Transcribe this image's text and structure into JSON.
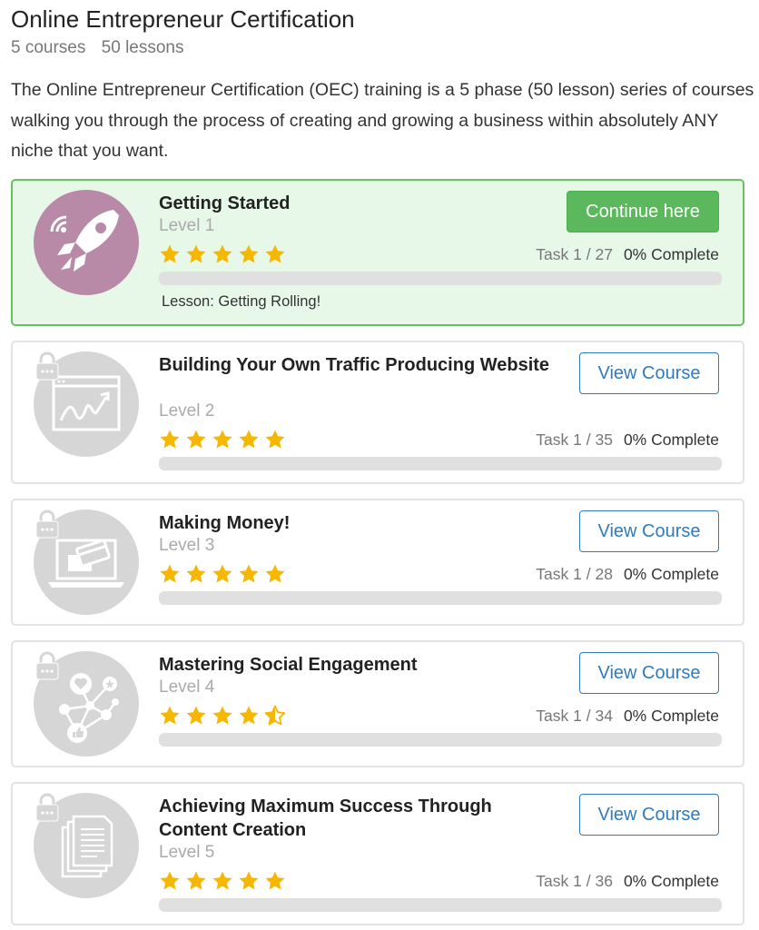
{
  "page": {
    "title": "Online Entrepreneur Certification",
    "courses_count": "5 courses",
    "lessons_count": "50 lessons",
    "description": "The Online Entrepreneur Certification (OEC) training is a 5 phase (50 lesson) series of courses walking you through the process of creating and growing a business within absolutely ANY niche that you want."
  },
  "colors": {
    "active_border": "#66c15f",
    "active_background": "#e8f8e8",
    "continue_button": "#5cb85c",
    "view_button": "#2e7bbf",
    "star": "#f5b700",
    "active_icon": "#b98aa8",
    "locked_icon": "#d6d6d6"
  },
  "courses": [
    {
      "title": "Getting Started",
      "level": "Level 1",
      "rating": 5,
      "task": "Task 1 / 27",
      "complete": "0% Complete",
      "progress": 0,
      "button": "Continue here",
      "lesson": "Lesson: Getting Rolling!",
      "icon": "rocket-icon",
      "locked": false
    },
    {
      "title": "Building Your Own Traffic Producing Website",
      "level": "Level 2",
      "rating": 5,
      "task": "Task 1 / 35",
      "complete": "0% Complete",
      "progress": 0,
      "button": "View Course",
      "icon": "website-chart-icon",
      "locked": true
    },
    {
      "title": "Making Money!",
      "level": "Level 3",
      "rating": 5,
      "task": "Task 1 / 28",
      "complete": "0% Complete",
      "progress": 0,
      "button": "View Course",
      "icon": "laptop-card-icon",
      "locked": true
    },
    {
      "title": "Mastering Social Engagement",
      "level": "Level 4",
      "rating": 4.5,
      "task": "Task 1 / 34",
      "complete": "0% Complete",
      "progress": 0,
      "button": "View Course",
      "icon": "social-network-icon",
      "locked": true
    },
    {
      "title": "Achieving Maximum Success Through Content Creation",
      "level": "Level 5",
      "rating": 5,
      "task": "Task 1 / 36",
      "complete": "0% Complete",
      "progress": 0,
      "button": "View Course",
      "icon": "documents-icon",
      "locked": true
    }
  ]
}
